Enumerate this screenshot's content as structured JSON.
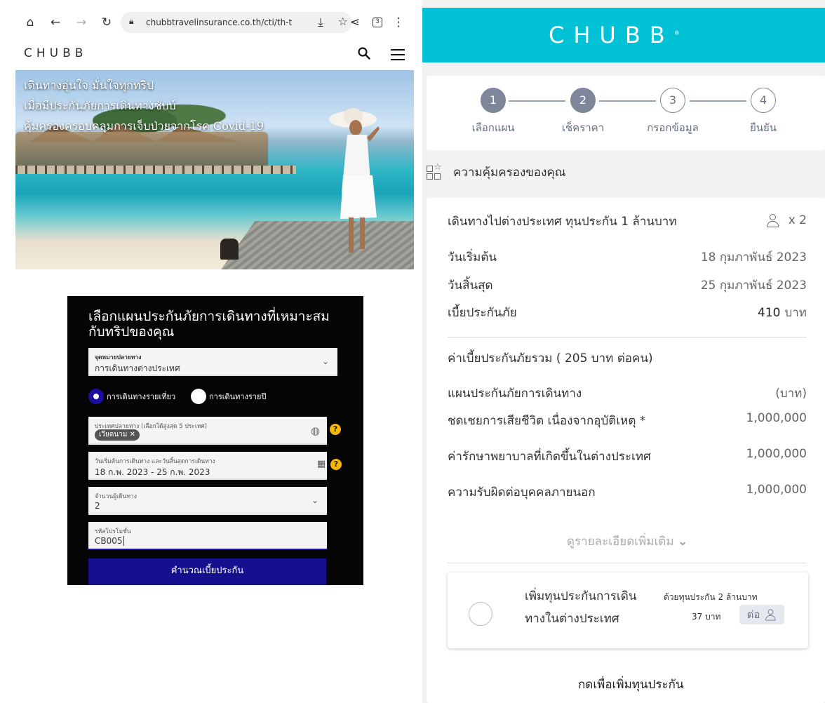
{
  "browser": {
    "url": "chubbtravelinsurance.co.th/cti/th-t",
    "tab_count": "3"
  },
  "site": {
    "logo_text": "CHUBB"
  },
  "hero": {
    "lines": [
      "เดินทางอุ่นใจ มั่นใจทุกทริป",
      "เมื่อมีประกันภัยการเดินทางชับบ์",
      "คุ้มครองครอบคลุมการเจ็บป่วยจากโรค Covid-19"
    ]
  },
  "quote_form": {
    "heading": "เลือกแผนประกันภัยการเดินทางที่เหมาะสมกับทริปของคุณ",
    "destination_type": {
      "label": "จุดหมายปลายทาง",
      "value": "การเดินทางต่างประเทศ"
    },
    "trip_options": [
      {
        "label": "การเดินทางรายเที่ยว",
        "selected": true
      },
      {
        "label": "การเดินทางรายปี",
        "selected": false
      }
    ],
    "countries": {
      "label": "ประเทศปลายทาง (เลือกได้สูงสุด 5 ประเทศ)",
      "chip": "เวียดนาม"
    },
    "dates": {
      "label": "วันเริ่มต้นการเดินทาง และวันสิ้นสุดการเดินทาง",
      "value": "18 ก.พ. 2023 - 25 ก.พ. 2023"
    },
    "travellers": {
      "label": "จำนวนผู้เดินทาง",
      "value": "2"
    },
    "promo": {
      "label": "รหัสโปรโมชั่น",
      "value": "CB005"
    },
    "submit_label": "คำนวณเบี้ยประกัน",
    "help_glyph": "?"
  },
  "chubb_banner": {
    "logo_text": "CHUBB",
    "registered": "®"
  },
  "stepper": {
    "steps": [
      {
        "number": "1",
        "label": "เลือกแผน",
        "state": "done"
      },
      {
        "number": "2",
        "label": "เช็คราคา",
        "state": "done"
      },
      {
        "number": "3",
        "label": "กรอกข้อมูล",
        "state": "todo"
      },
      {
        "number": "4",
        "label": "ยืนยัน",
        "state": "todo"
      }
    ]
  },
  "coverage": {
    "heading": "ความคุ้มครองของคุณ",
    "plan_title": "เดินทางไปต่างประเทศ ทุนประกัน 1 ล้านบาท",
    "traveller_multiplier": "x 2",
    "start_label": "วันเริ่มต้น",
    "start_value": "18 กุมภาพันธ์ 2023",
    "end_label": "วันสิ้นสุด",
    "end_value": "25 กุมภาพันธ์ 2023",
    "premium_label": "เบี้ยประกันภัย",
    "premium_amount": "410",
    "premium_unit": "บาท",
    "total_premium_text": "ค่าเบี้ยประกันภัยรวม ( 205 บาท ต่อคน)",
    "table_header_label": "แผนประกันภัยการเดินทาง",
    "table_header_unit": "(บาท)",
    "benefits": [
      {
        "label": "ชดเชยการเสียชีวิต เนื่องจากอุบัติเหตุ *",
        "value": "1,000,000"
      },
      {
        "label": "ค่ารักษาพยาบาลที่เกิดขึ้นในต่างประเทศ",
        "value": "1,000,000"
      },
      {
        "label": "ความรับผิดต่อบุคคลภายนอก",
        "value": "1,000,000"
      }
    ],
    "more_details": "ดูรายละเอียดเพิ่มเติม",
    "addon": {
      "title_line1": "เพิ่มทุนประกันการเดิน",
      "title_line2": "ทางในต่างประเทศ",
      "subtitle": "ด้วยทุนประกัน 2 ล้านบาท",
      "price": "37  บาท",
      "per_person": "ต่อ"
    },
    "add_coverage_text": "กดเพื่อเพิ่มทุนประกัน"
  }
}
